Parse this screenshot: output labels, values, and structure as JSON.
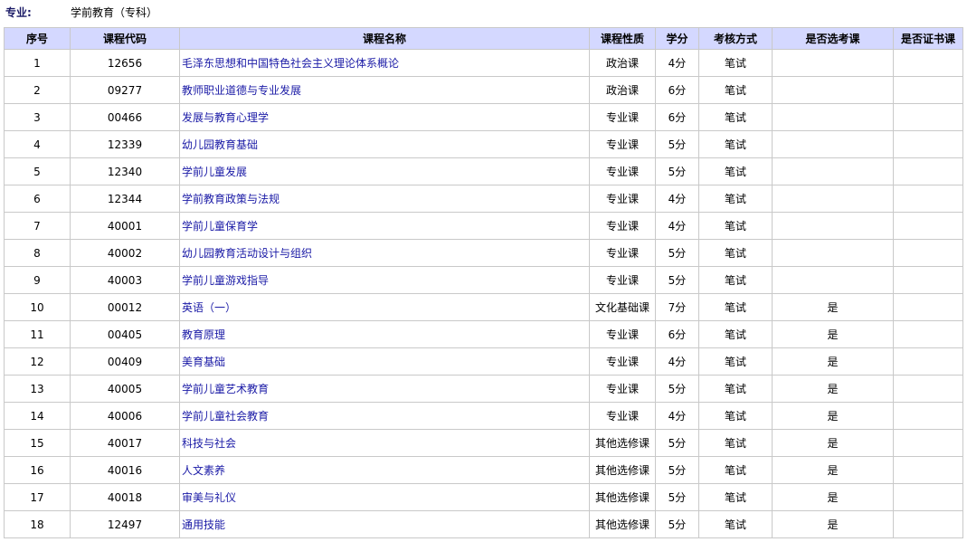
{
  "major": {
    "label": "专业:",
    "value": "学前教育（专科）"
  },
  "columns": [
    "序号",
    "课程代码",
    "课程名称",
    "课程性质",
    "学分",
    "考核方式",
    "是否选考课",
    "是否证书课"
  ],
  "rows": [
    {
      "no": "1",
      "code": "12656",
      "name": "毛泽东思想和中国特色社会主义理论体系概论",
      "type": "政治课",
      "credit": "4分",
      "exam": "笔试",
      "elective": "",
      "cert": ""
    },
    {
      "no": "2",
      "code": "09277",
      "name": "教师职业道德与专业发展",
      "type": "政治课",
      "credit": "6分",
      "exam": "笔试",
      "elective": "",
      "cert": ""
    },
    {
      "no": "3",
      "code": "00466",
      "name": "发展与教育心理学",
      "type": "专业课",
      "credit": "6分",
      "exam": "笔试",
      "elective": "",
      "cert": ""
    },
    {
      "no": "4",
      "code": "12339",
      "name": "幼儿园教育基础",
      "type": "专业课",
      "credit": "5分",
      "exam": "笔试",
      "elective": "",
      "cert": ""
    },
    {
      "no": "5",
      "code": "12340",
      "name": "学前儿童发展",
      "type": "专业课",
      "credit": "5分",
      "exam": "笔试",
      "elective": "",
      "cert": ""
    },
    {
      "no": "6",
      "code": "12344",
      "name": "学前教育政策与法规",
      "type": "专业课",
      "credit": "4分",
      "exam": "笔试",
      "elective": "",
      "cert": ""
    },
    {
      "no": "7",
      "code": "40001",
      "name": "学前儿童保育学",
      "type": "专业课",
      "credit": "4分",
      "exam": "笔试",
      "elective": "",
      "cert": ""
    },
    {
      "no": "8",
      "code": "40002",
      "name": "幼儿园教育活动设计与组织",
      "type": "专业课",
      "credit": "5分",
      "exam": "笔试",
      "elective": "",
      "cert": ""
    },
    {
      "no": "9",
      "code": "40003",
      "name": "学前儿童游戏指导",
      "type": "专业课",
      "credit": "5分",
      "exam": "笔试",
      "elective": "",
      "cert": ""
    },
    {
      "no": "10",
      "code": "00012",
      "name": "英语（一）",
      "type": "文化基础课",
      "credit": "7分",
      "exam": "笔试",
      "elective": "是",
      "cert": ""
    },
    {
      "no": "11",
      "code": "00405",
      "name": "教育原理",
      "type": "专业课",
      "credit": "6分",
      "exam": "笔试",
      "elective": "是",
      "cert": ""
    },
    {
      "no": "12",
      "code": "00409",
      "name": "美育基础",
      "type": "专业课",
      "credit": "4分",
      "exam": "笔试",
      "elective": "是",
      "cert": ""
    },
    {
      "no": "13",
      "code": "40005",
      "name": "学前儿童艺术教育",
      "type": "专业课",
      "credit": "5分",
      "exam": "笔试",
      "elective": "是",
      "cert": ""
    },
    {
      "no": "14",
      "code": "40006",
      "name": "学前儿童社会教育",
      "type": "专业课",
      "credit": "4分",
      "exam": "笔试",
      "elective": "是",
      "cert": ""
    },
    {
      "no": "15",
      "code": "40017",
      "name": "科技与社会",
      "type": "其他选修课",
      "credit": "5分",
      "exam": "笔试",
      "elective": "是",
      "cert": ""
    },
    {
      "no": "16",
      "code": "40016",
      "name": "人文素养",
      "type": "其他选修课",
      "credit": "5分",
      "exam": "笔试",
      "elective": "是",
      "cert": ""
    },
    {
      "no": "17",
      "code": "40018",
      "name": "审美与礼仪",
      "type": "其他选修课",
      "credit": "5分",
      "exam": "笔试",
      "elective": "是",
      "cert": ""
    },
    {
      "no": "18",
      "code": "12497",
      "name": "通用技能",
      "type": "其他选修课",
      "credit": "5分",
      "exam": "笔试",
      "elective": "是",
      "cert": ""
    }
  ]
}
